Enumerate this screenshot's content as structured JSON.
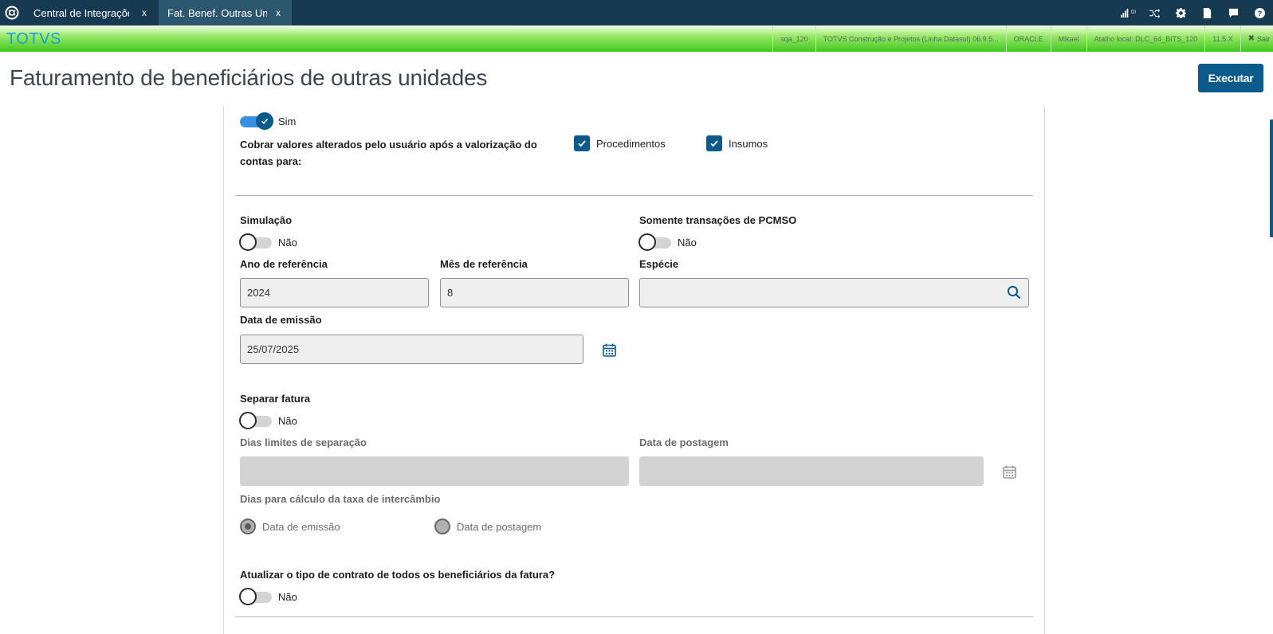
{
  "topbar": {
    "tabs": [
      {
        "label": "Central de Integrações",
        "close": "x"
      },
      {
        "label": "Fat. Benef. Outras Uni",
        "close": "x"
      }
    ],
    "icons": [
      "signal-icon",
      "shuffle-icon",
      "gear-icon",
      "document-icon",
      "chat-icon",
      "help-icon"
    ],
    "signal_text": "DI"
  },
  "greenbar": {
    "brand": "TOTVS",
    "status": [
      "sqa_120",
      "TOTVS Construção e Projetos (Linha Datasul) 06.9.5...",
      "ORACLE",
      "Mikael",
      "Atalho local: DLC_64_BITS_120",
      "11.5.X"
    ],
    "logout": "Sair"
  },
  "header": {
    "title": "Faturamento de beneficiários de outras unidades",
    "execute": "Executar"
  },
  "form": {
    "top_switch_text": "Sim",
    "cobrar_label": "Cobrar valores alterados pelo usuário após a valorização do contas para:",
    "check_procedimentos": "Procedimentos",
    "check_insumos": "Insumos",
    "simulacao_label": "Simulação",
    "simulacao_value": "Não",
    "pcmso_label": "Somente transações de PCMSO",
    "pcmso_value": "Não",
    "ano_label": "Ano de referência",
    "ano_value": "2024",
    "mes_label": "Mês de referência",
    "mes_value": "8",
    "especie_label": "Espécie",
    "especie_value": "",
    "data_emissao_label": "Data de emissão",
    "data_emissao_value": "25/07/2025",
    "separar_label": "Separar fatura",
    "separar_value": "Não",
    "dias_limites_label": "Dias limites de separação",
    "data_postagem_label": "Data de postagem",
    "dias_calc_label": "Dias para cálculo da taxa de intercâmbio",
    "radio_emissao": "Data de emissão",
    "radio_postagem": "Data de postagem",
    "atualizar_label": "Atualizar o tipo de contrato de todos os beneficiários da fatura?",
    "atualizar_value": "Não"
  },
  "colors": {
    "topbar": "#163a52",
    "active_tab": "#2d566f",
    "primary": "#0c5a8c",
    "brand": "#1aa0d8",
    "switch_on": "#3a8fde"
  }
}
